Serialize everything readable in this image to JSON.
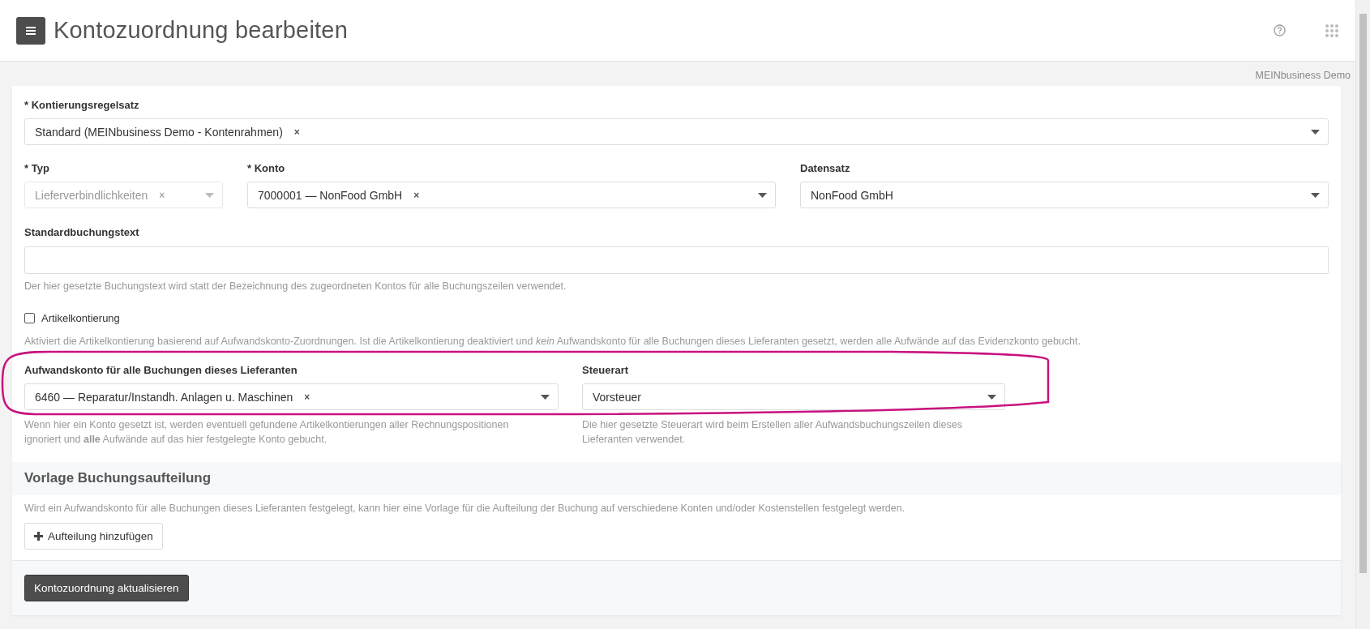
{
  "header": {
    "title": "Kontozuordnung bearbeiten"
  },
  "company": "MEINbusiness Demo",
  "regelsatz": {
    "label": "* Kontierungsregelsatz",
    "value": "Standard (MEINbusiness Demo - Kontenrahmen)",
    "clear": "×",
    "disabled": false
  },
  "typ": {
    "label": "* Typ",
    "value": "Lieferverbindlichkeiten",
    "clear": "×",
    "disabled": true
  },
  "konto": {
    "label": "* Konto",
    "value": "7000001 — NonFood GmbH",
    "clear": "×",
    "disabled": false
  },
  "datensatz": {
    "label": "Datensatz",
    "value": "NonFood GmbH",
    "disabled": false
  },
  "buchungstext": {
    "label": "Standardbuchungstext",
    "help": "Der hier gesetzte Buchungstext wird statt der Bezeichnung des zugeordneten Kontos für alle Buchungszeilen verwendet."
  },
  "artikelkontierung": {
    "label": "Artikelkontierung",
    "checked": false,
    "help": "Aktiviert die Artikelkontierung basierend auf Aufwandskonto-Zuordnungen. Ist die Artikelkontierung deaktiviert und *kein* Aufwandskonto für alle Buchungen dieses Lieferanten gesetzt, werden alle Aufwände auf das Evidenzkonto gebucht."
  },
  "aufwandskonto": {
    "label": "Aufwandskonto für alle Buchungen dieses Lieferanten",
    "value": "6460 — Reparatur/Instandh. Anlagen u. Maschinen",
    "clear": "×",
    "disabled": false,
    "help": "Wenn hier ein Konto gesetzt ist, werden eventuell gefundene Artikelkontierungen aller Rechnungspositionen ignoriert und **alle** Aufwände auf das hier festgelegte Konto gebucht."
  },
  "steuerart": {
    "label": "Steuerart",
    "value": "Vorsteuer",
    "disabled": false,
    "help": "Die hier gesetzte Steuerart wird beim Erstellen aller Aufwandsbuchungszeilen dieses Lieferanten verwendet."
  },
  "vorlage": {
    "title": "Vorlage Buchungsaufteilung",
    "help": "Wird ein Aufwandskonto für alle Buchungen dieses Lieferanten festgelegt, kann hier eine Vorlage für die Aufteilung der Buchung auf verschiedene Konten und/oder Kostenstellen festgelegt werden.",
    "add_button": "Aufteilung hinzufügen"
  },
  "submit": "Kontozuordnung aktualisieren"
}
